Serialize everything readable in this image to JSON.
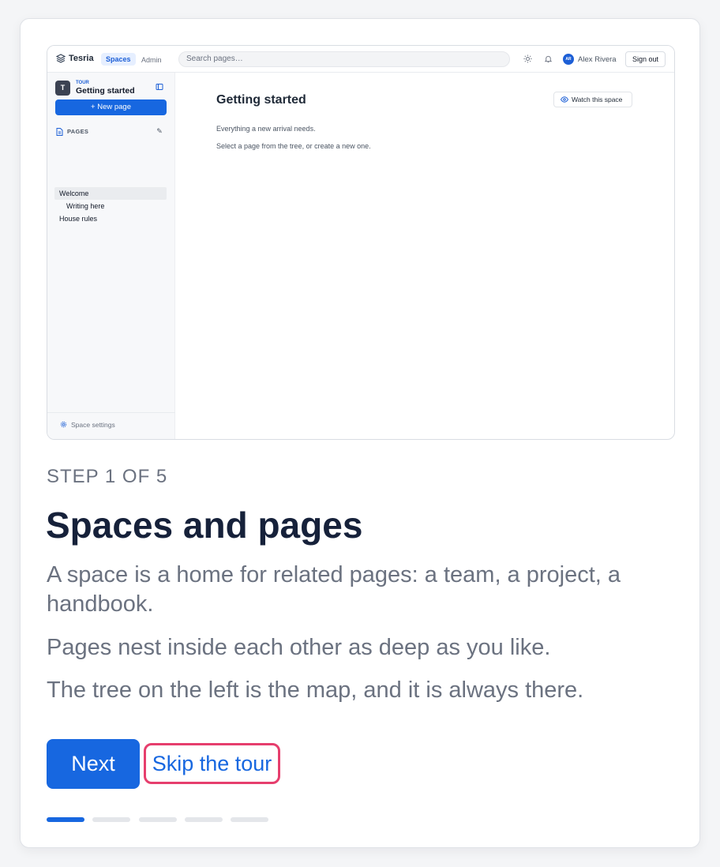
{
  "preview": {
    "brand": "Tesria",
    "nav_active": "Spaces",
    "nav_admin": "Admin",
    "search_placeholder": "Search pages…",
    "avatar_initials": "AR",
    "user_name": "Alex Rivera",
    "sign_out": "Sign out",
    "space_badge": "T",
    "space_kicker": "TOUR",
    "space_name": "Getting started",
    "new_page": "+ New page",
    "pages_heading": "PAGES",
    "tree": [
      "Welcome",
      "Writing here",
      "House rules"
    ],
    "space_settings": "Space settings",
    "page_title": "Getting started",
    "watch": "Watch this space",
    "para1": "Everything a new arrival needs.",
    "para2": "Select a page from the tree, or create a new one."
  },
  "tour": {
    "step": "STEP 1 OF 5",
    "title": "Spaces and pages",
    "paragraphs": [
      "A space is a home for related pages: a team, a project, a handbook.",
      "Pages nest inside each other as deep as you like.",
      "The tree on the left is the map, and it is always there."
    ],
    "next_label": "Next",
    "skip_label": "Skip the tour",
    "current_step": 1,
    "total_steps": 5
  },
  "colors": {
    "accent": "#1767e0",
    "focus_ring": "#e63e6d",
    "title": "#16213a",
    "muted": "#6b7280"
  }
}
